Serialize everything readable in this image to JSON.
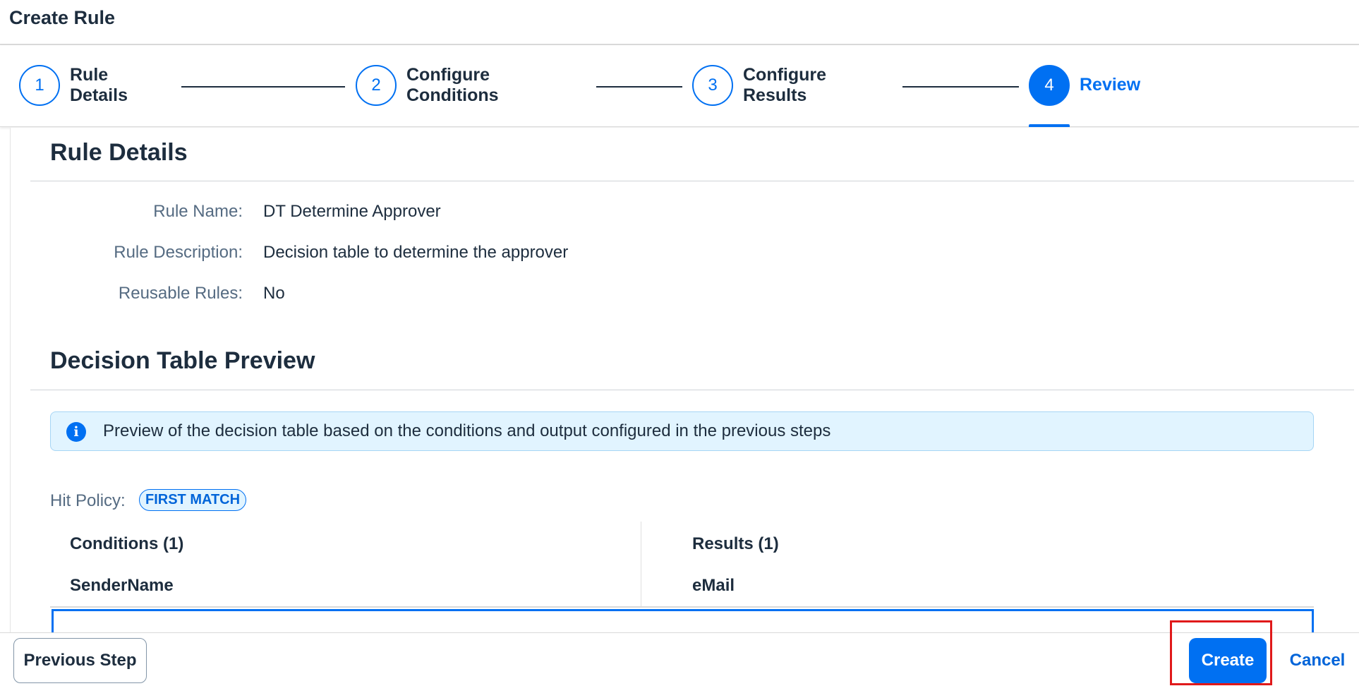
{
  "window": {
    "title": "Create Rule"
  },
  "wizard": {
    "steps": [
      {
        "number": "1",
        "label": "Rule Details"
      },
      {
        "number": "2",
        "label": "Configure Conditions"
      },
      {
        "number": "3",
        "label": "Configure Results"
      },
      {
        "number": "4",
        "label": "Review",
        "active": true
      }
    ]
  },
  "rule_details": {
    "title": "Rule Details",
    "fields": [
      {
        "label": "Rule Name:",
        "value": "DT Determine Approver"
      },
      {
        "label": "Rule Description:",
        "value": "Decision table to determine the approver"
      },
      {
        "label": "Reusable Rules:",
        "value": "No"
      }
    ]
  },
  "decision_table": {
    "title": "Decision Table Preview",
    "info": {
      "icon": "info-icon",
      "text": "Preview of the decision table based on the conditions and output configured in the previous steps"
    },
    "hit_policy_label": "Hit Policy:",
    "hit_policy_value": "FIRST MATCH",
    "conditions_header": "Conditions (1)",
    "results_header": "Results (1)",
    "condition_columns": [
      "SenderName"
    ],
    "result_columns": [
      "eMail"
    ]
  },
  "footer": {
    "previous_label": "Previous Step",
    "create_label": "Create",
    "cancel_label": "Cancel"
  },
  "colors": {
    "accent": "#0070f2",
    "text": "#1d2d3e",
    "label": "#556b82",
    "info_bg": "#e1f4ff",
    "highlight": "#e0191a"
  }
}
